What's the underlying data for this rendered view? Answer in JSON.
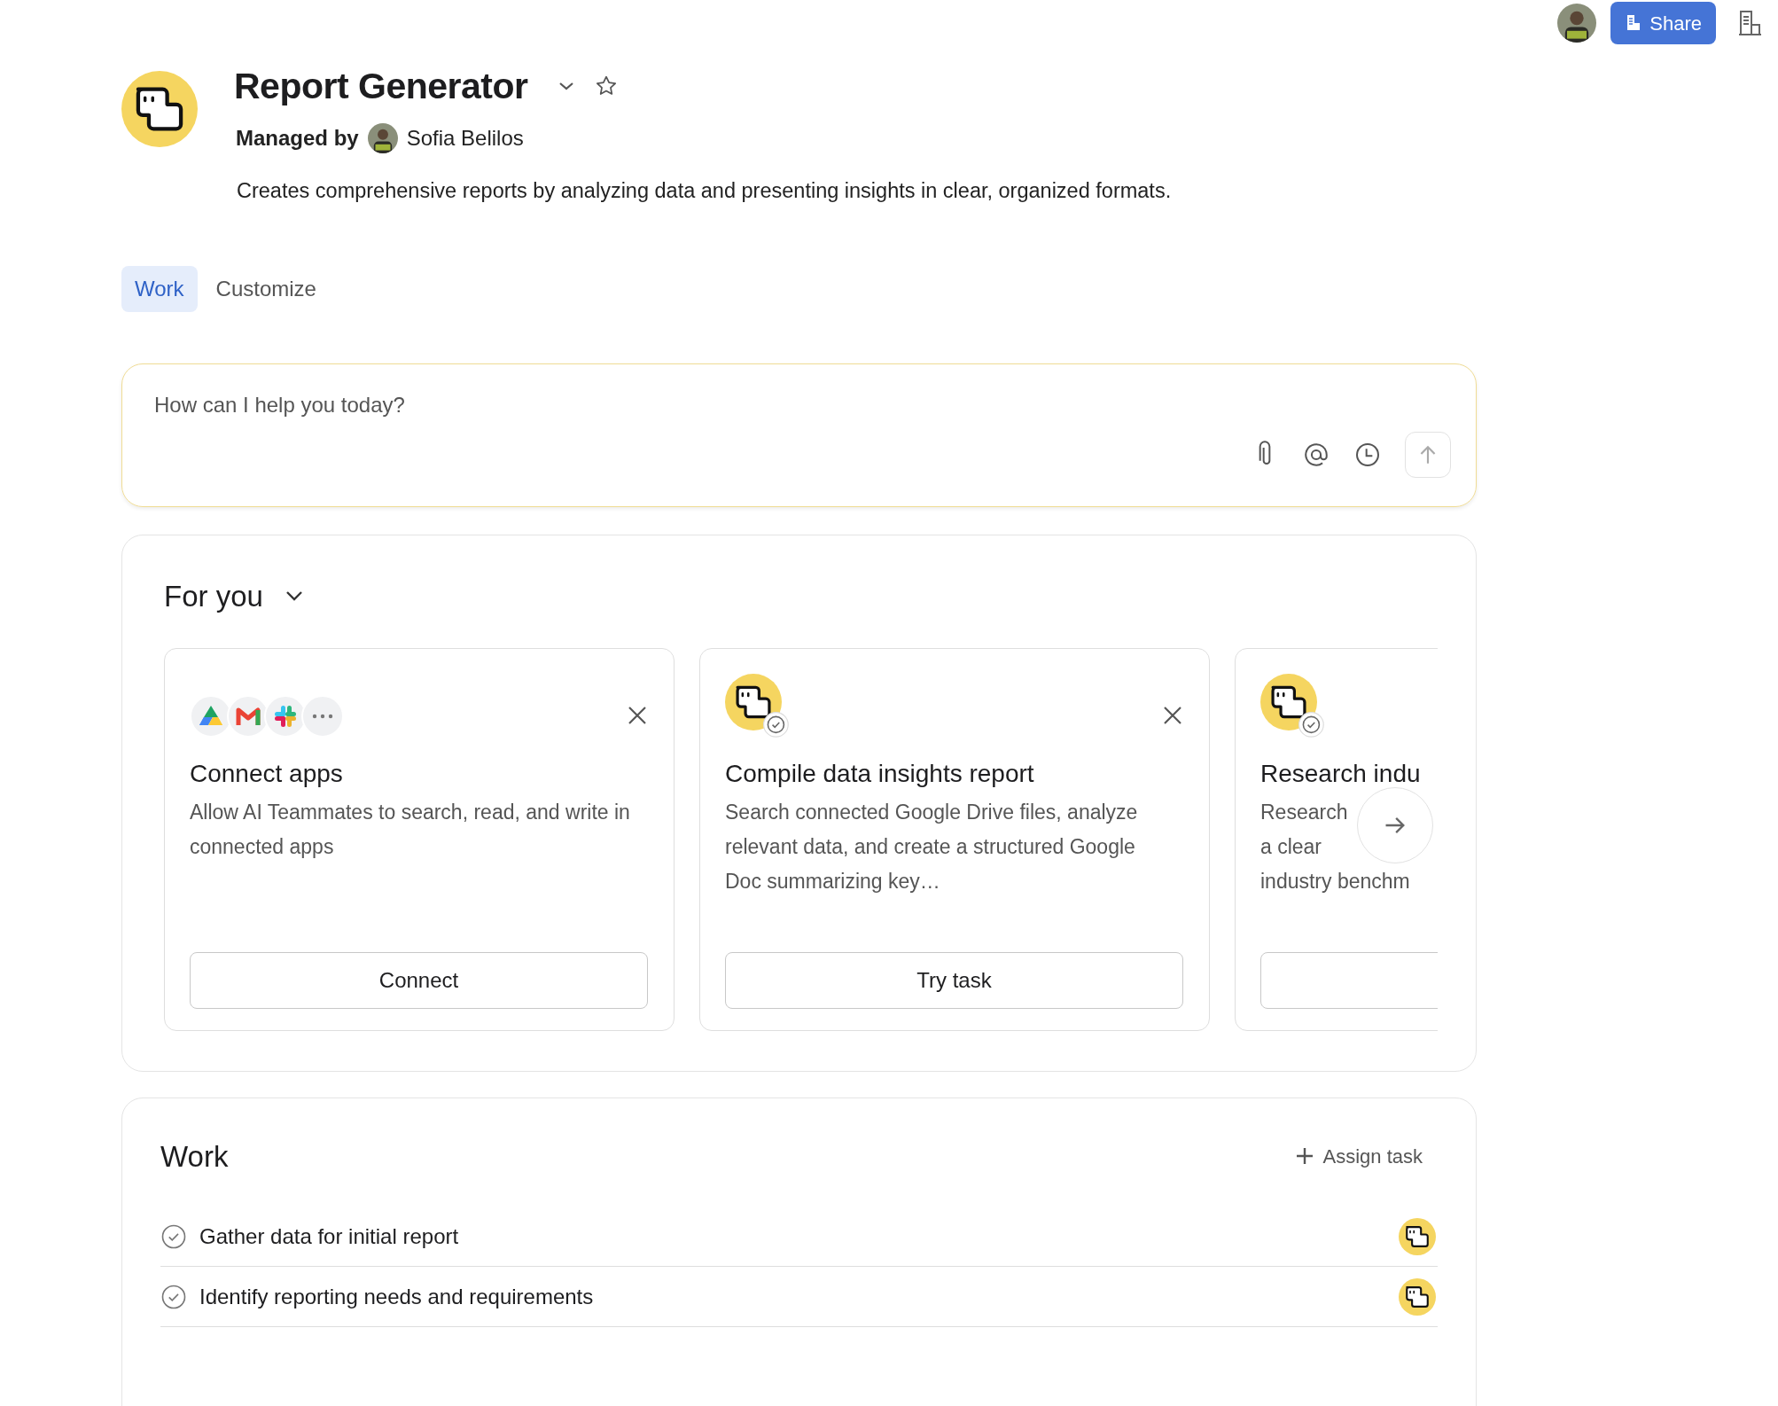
{
  "top_bar": {
    "share": "Share"
  },
  "agent": {
    "name": "Report Generator",
    "managed_by_label": "Managed by",
    "manager": "Sofia Belilos",
    "description": "Creates comprehensive reports by analyzing data and presenting insights in clear, organized formats."
  },
  "tabs": [
    {
      "label": "Work",
      "selected": true
    },
    {
      "label": "Customize",
      "selected": false
    }
  ],
  "prompt": {
    "placeholder": "How can I help you today?"
  },
  "for_you": {
    "title": "For you",
    "cards": [
      {
        "kind": "apps",
        "title": "Connect apps",
        "description": "Allow AI Teammates to search, read, and write in connected apps",
        "button": "Connect",
        "dismissible": true
      },
      {
        "kind": "task",
        "title": "Compile data insights report",
        "description": "Search connected Google Drive files, analyze relevant data, and create a structured Google Doc summarizing key…",
        "button": "Try task",
        "dismissible": true
      },
      {
        "kind": "task",
        "title": "Research indu",
        "lines": [
          "Research",
          "a clear",
          "industry benchm"
        ],
        "dismissible": false
      }
    ]
  },
  "work": {
    "title": "Work",
    "assign": "Assign task",
    "tasks": [
      {
        "title": "Gather data for initial report"
      },
      {
        "title": "Identify reporting needs and requirements"
      }
    ]
  }
}
